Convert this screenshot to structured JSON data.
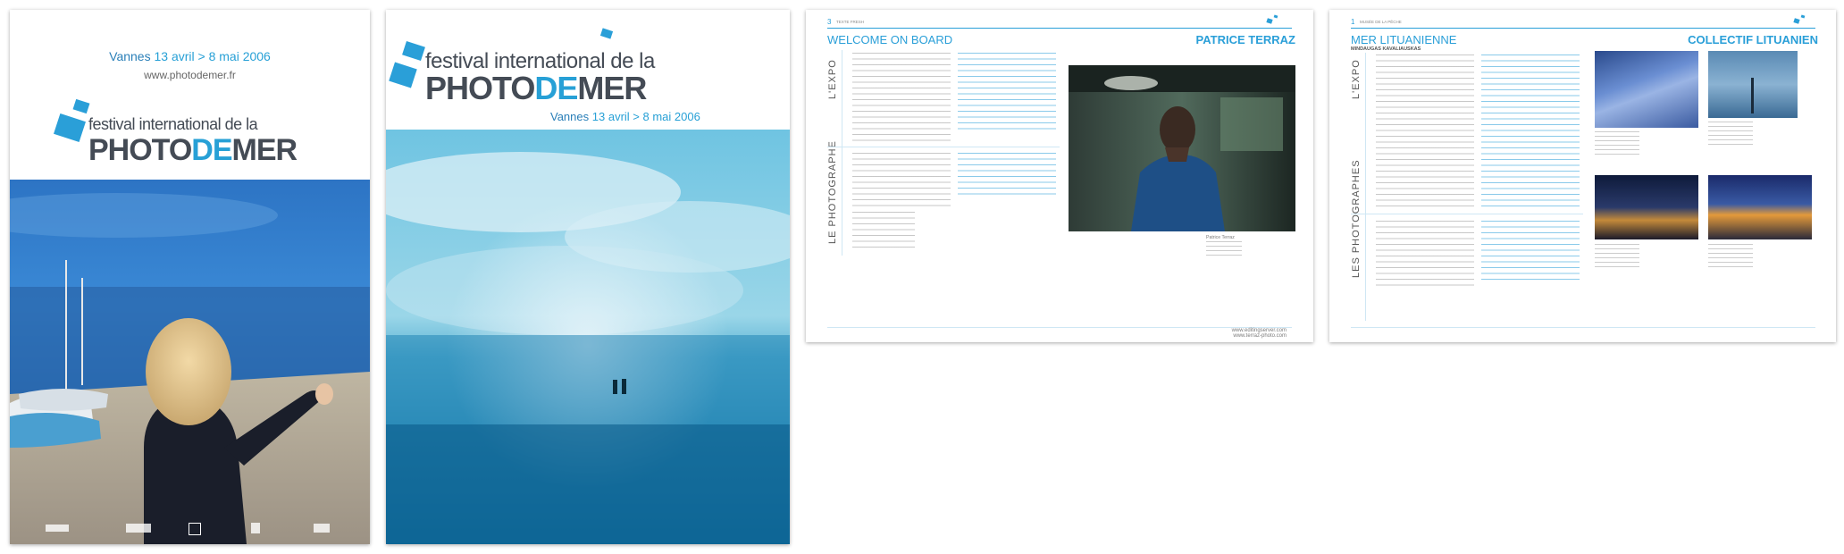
{
  "poster1": {
    "date_city": "Vannes",
    "date_range": "13 avril > 8 mai",
    "date_year": "2006",
    "url": "www.photodemer.fr",
    "logo_line1": "festival international de la",
    "logo_photo": "PHOTO",
    "logo_de": "DE",
    "logo_mer": "MER"
  },
  "poster2": {
    "logo_line1": "festival international de la",
    "logo_photo": "PHOTO",
    "logo_de": "DE",
    "logo_mer": "MER",
    "date_city": "Vannes",
    "date_range": "13 avril > 8 mai",
    "date_year": "2006"
  },
  "spread1": {
    "page_num": "3",
    "section_label": "TEXTE FRESH",
    "heading_left": "WELCOME ON BOARD",
    "heading_right": "PATRICE TERRAZ",
    "side_label_1": "L'EXPO",
    "side_label_2": "LE PHOTOGRAPHE",
    "caption": "Patrice Terraz",
    "footer_url_1": "www.editingserver.com",
    "footer_url_2": "www.terraz-photo.com"
  },
  "spread2": {
    "page_num": "1",
    "section_label": "MUSÉE DE LA PÊCHE",
    "heading_left": "MER LITUANIENNE",
    "subheading": "MINDAUGAS KAVALIAUSKAS",
    "heading_right": "COLLECTIF LITUANIEN",
    "side_label_1": "L'EXPO",
    "side_label_2": "LES PHOTOGRAPHES"
  },
  "colors": {
    "accent": "#2a9fd8",
    "logo_gray": "#444b55"
  }
}
